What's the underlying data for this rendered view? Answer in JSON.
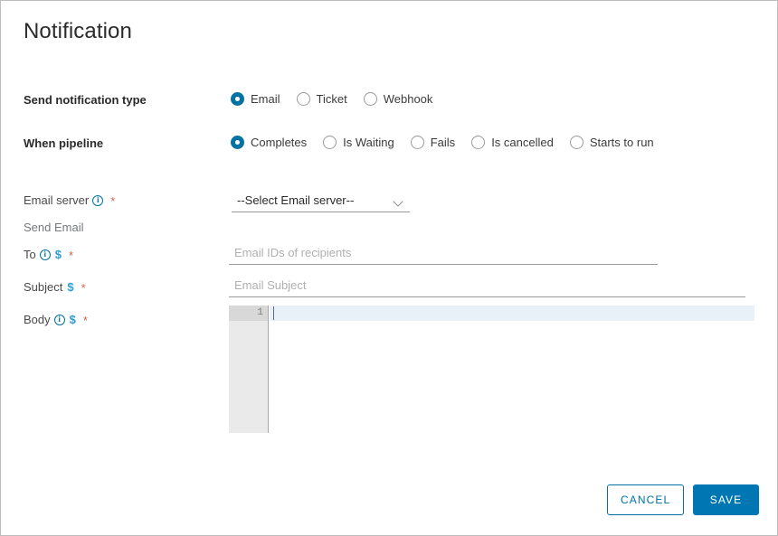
{
  "window": {
    "title": "Notification"
  },
  "notification_type": {
    "label": "Send notification type",
    "options": [
      {
        "label": "Email",
        "selected": true
      },
      {
        "label": "Ticket",
        "selected": false
      },
      {
        "label": "Webhook",
        "selected": false
      }
    ]
  },
  "when_pipeline": {
    "label": "When pipeline",
    "options": [
      {
        "label": "Completes",
        "selected": true
      },
      {
        "label": "Is Waiting",
        "selected": false
      },
      {
        "label": "Fails",
        "selected": false
      },
      {
        "label": "Is cancelled",
        "selected": false
      },
      {
        "label": "Starts to run",
        "selected": false
      }
    ]
  },
  "fields": {
    "email_server": {
      "label": "Email server",
      "info_icon": "info-circle-icon",
      "required_marker": "*",
      "selected_option": "--Select Email server--"
    },
    "section_heading": "Send Email",
    "to": {
      "label": "To",
      "info_icon": "info-circle-icon",
      "variable_icon": "$",
      "required_marker": "*",
      "placeholder": "Email IDs of recipients",
      "value": ""
    },
    "subject": {
      "label": "Subject",
      "variable_icon": "$",
      "required_marker": "*",
      "placeholder": "Email Subject",
      "value": ""
    },
    "body": {
      "label": "Body",
      "info_icon": "info-circle-icon",
      "variable_icon": "$",
      "required_marker": "*",
      "editor_line_number": "1",
      "editor_content": ""
    }
  },
  "footer": {
    "cancel_label": "CANCEL",
    "save_label": "SAVE"
  },
  "colors": {
    "accent_blue": "#0072a3",
    "save_blue": "#0077b3",
    "required_red": "#e0624a",
    "variable_blue": "#2a9fd6",
    "muted_text": "#74797d"
  }
}
